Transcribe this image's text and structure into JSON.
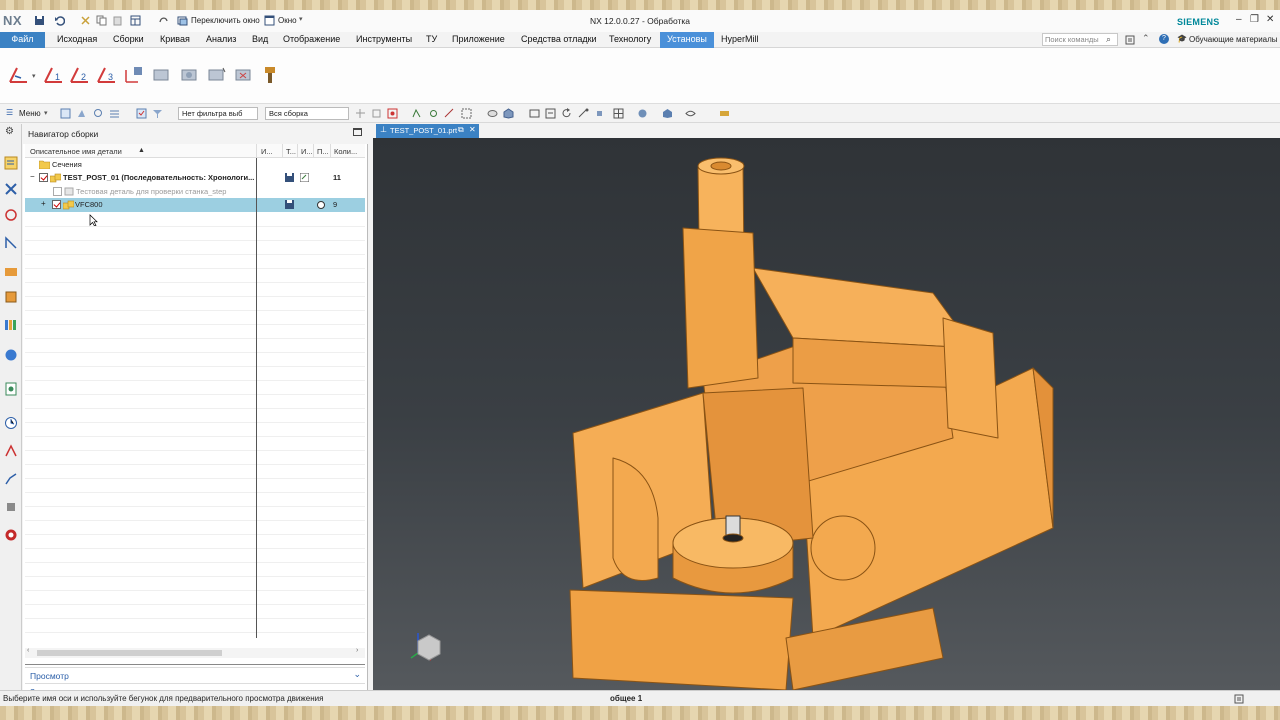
{
  "window": {
    "logo": "NX",
    "title": "NX 12.0.0.27 - Обработка",
    "brand": "SIEMENS",
    "quick_access": {
      "switch_window": "Переключить окно",
      "window_menu": "Окно"
    }
  },
  "menu": {
    "file": "Файл",
    "items": [
      "Исходная",
      "Сборки",
      "Кривая",
      "Анализ",
      "Вид",
      "Отображение",
      "Инструменты",
      "ТУ",
      "Приложение",
      "Средства отладки",
      "Технологу",
      "Установы",
      "HyperMill"
    ],
    "active": "Установы",
    "search_placeholder": "Поиск команды",
    "learning": "Обучающие материалы"
  },
  "toolbar": {
    "menu_label": "Меню",
    "filter_value": "Нет фильтра выб",
    "scope_value": "Вся сборка"
  },
  "navigator": {
    "title": "Навигатор сборки",
    "columns": {
      "name": "Описательное имя детали",
      "c1": "И...",
      "c2": "Т...",
      "c3": "И...",
      "c4": "П...",
      "c5": "Коли..."
    },
    "rows": [
      {
        "name": "Сечения",
        "count": ""
      },
      {
        "name": "TEST_POST_01 (Последовательность: Хронологи...",
        "count": "11"
      },
      {
        "name": "Тестовая деталь для проверки станка_step",
        "count": ""
      },
      {
        "name": "VFC800",
        "count": "9"
      }
    ],
    "panels": [
      "Просмотр",
      "Зависимости"
    ]
  },
  "document": {
    "tab": "TEST_POST_01.prt"
  },
  "viewport": {
    "model_color": "#f2a74c",
    "background": "#3a3f44"
  },
  "status": {
    "message": "Выберите имя оси и используйте бегунок для предварительного просмотра движения",
    "selection": "общее 1"
  }
}
